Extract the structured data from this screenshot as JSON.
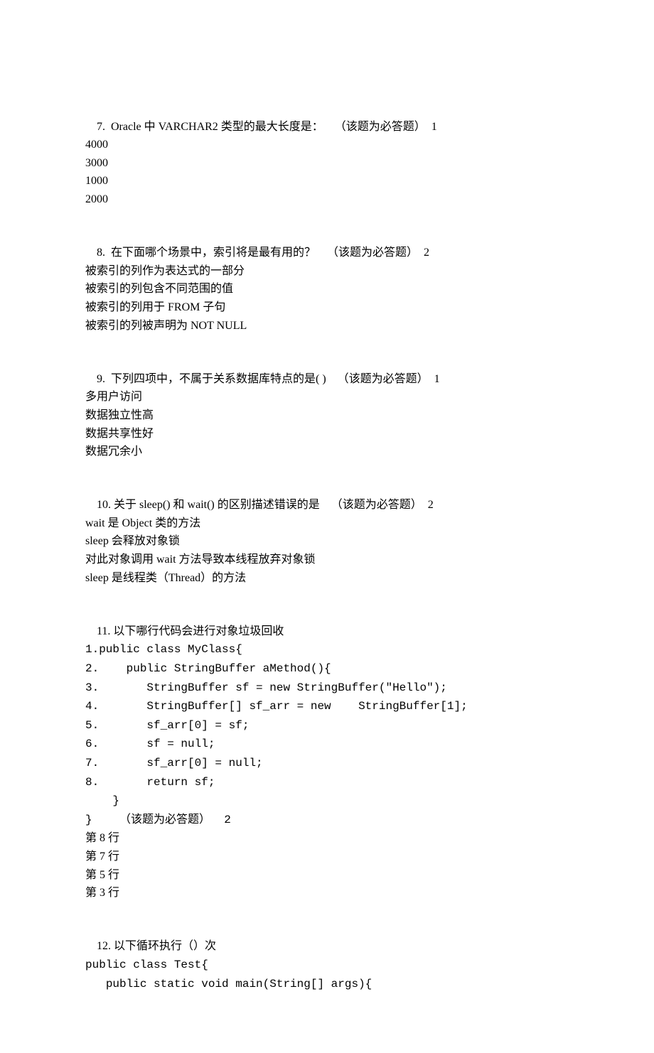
{
  "questions": [
    {
      "num": "7.",
      "prompt": "Oracle 中 VARCHAR2 类型的最大长度是：    （该题为必答题）  1",
      "options": [
        "4000",
        "3000",
        "1000",
        "2000"
      ]
    },
    {
      "num": "8.",
      "prompt": "在下面哪个场景中，索引将是最有用的？    （该题为必答题）  2",
      "options": [
        "被索引的列作为表达式的一部分",
        "被索引的列包含不同范围的值",
        "被索引的列用于 FROM 子句",
        "被索引的列被声明为 NOT NULL"
      ]
    },
    {
      "num": "9.",
      "prompt": "下列四项中，不属于关系数据库特点的是( )    （该题为必答题）  1",
      "options": [
        "多用户访问",
        "数据独立性高",
        "数据共享性好",
        "数据冗余小"
      ]
    },
    {
      "num": "10.",
      "prompt": "关于 sleep() 和 wait() 的区别描述错误的是    （该题为必答题）  2",
      "options": [
        "wait 是 Object 类的方法",
        "sleep 会释放对象锁",
        "对此对象调用 wait 方法导致本线程放弃对象锁",
        "sleep 是线程类（Thread）的方法"
      ]
    },
    {
      "num": "11.",
      "prompt": "以下哪行代码会进行对象垃圾回收",
      "code": [
        "1.public class MyClass{",
        "2.    public StringBuffer aMethod(){",
        "3.       StringBuffer sf = new StringBuffer(\"Hello\");",
        "4.       StringBuffer[] sf_arr = new    StringBuffer[1];",
        "5.       sf_arr[0] = sf;",
        "6.       sf = null;",
        "7.       sf_arr[0] = null;",
        "8.       return sf;",
        "    }",
        "}    （该题为必答题）  2"
      ],
      "options": [
        "第 8 行",
        "第 7 行",
        "第 5 行",
        "第 3 行"
      ]
    },
    {
      "num": "12.",
      "prompt": "以下循环执行（）次",
      "code": [
        "public class Test{",
        "   public static void main(String[] args){"
      ],
      "options": []
    }
  ]
}
